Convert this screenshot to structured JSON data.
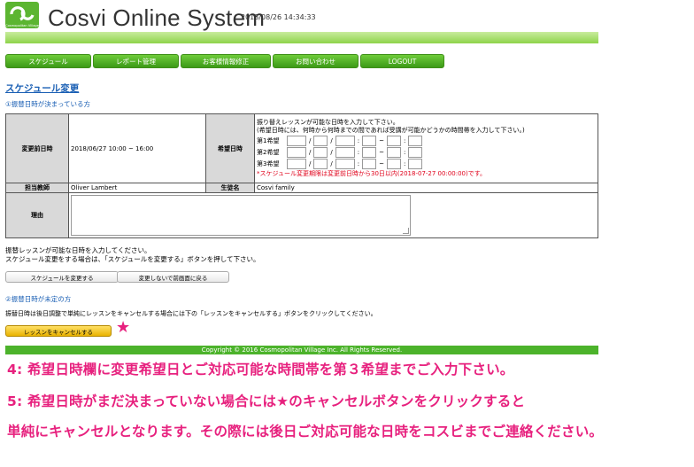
{
  "header": {
    "logo_caption": "Cosmopolitan Village",
    "title": "Cosvi Online System",
    "timestamp": "2018/08/26 14:34:33",
    "brand_color": "#5cb531"
  },
  "nav": {
    "items": [
      "スケジュール",
      "レポート管理",
      "お客様情報修正",
      "お問い合わせ",
      "LOGOUT"
    ]
  },
  "page_title": "スケジュール変更",
  "section1_title": "①振替日時が決まっている方",
  "table": {
    "before_label": "変更前日時",
    "before_value": "2018/06/27  10:00 ~ 16:00",
    "wish_label": "希望日時",
    "wish_note_1": "振り替えレッスンが可能な日時を入力して下さい。",
    "wish_note_2": "(希望日時には、何時から何時までの間であれば受講が可能かどうかの時間帯を入力して下さい。)",
    "wish_rows": [
      "第1希望",
      "第2希望",
      "第3希望"
    ],
    "slash": "/",
    "colon": ":",
    "tilde": "~",
    "deadline_note": "*スケジュール変更期限は変更前日時から30日以内(2018-07-27 00:00:00)です。",
    "teacher_label": "担当教師",
    "teacher_value": "Oliver Lambert",
    "student_label": "生徒名",
    "student_value": "Cosvi family",
    "reason_label": "理由",
    "reason_value": ""
  },
  "help_text_1": "振替レッスンが可能な日時を入力してください。",
  "help_text_2": "スケジュール変更をする場合は、「スケジュールを変更する」ボタンを押して下さい。",
  "buttons": {
    "change": "スケジュールを変更する",
    "back": "変更しないで前画面に戻る",
    "cancel": "レッスンをキャンセルする"
  },
  "section2_title": "②振替日時が未定の方",
  "cancel_help": "振替日時は後日調整で単純にレッスンをキャンセルする場合には下の「レッスンをキャンセルする」ボタンをクリックしてください。",
  "star": "★",
  "footer": "Copyright © 2016 Cosmopolitan Village Inc. All Rights Reserved.",
  "annotations": [
    "4: 希望日時欄に変更希望日とご対応可能な時間帯を第３希望までご入力下さい。",
    "5: 希望日時がまだ決まっていない場合には★のキャンセルボタンをクリックすると",
    "単純にキャンセルとなります。その際には後日ご対応可能な日時をコスビまでご連絡ください。"
  ],
  "colors": {
    "accent_green": "#4cb32b",
    "link_blue": "#1a5fb4",
    "annotation_pink": "#e7217e",
    "warning_red": "#e0001a"
  }
}
